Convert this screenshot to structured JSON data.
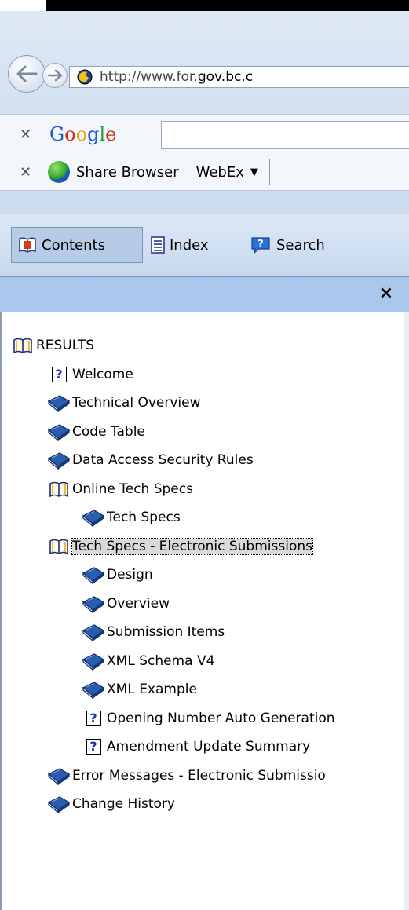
{
  "browser": {
    "address_prefix": "http://www.for.",
    "address_domain": "gov.bc.c",
    "google_label": "Google",
    "toolbar": {
      "share_browser_label": "Share Browser",
      "webex_label": "WebEx"
    }
  },
  "help": {
    "tabs": [
      {
        "label": "Contents",
        "active": true
      },
      {
        "label": "Index"
      },
      {
        "label": "Search"
      }
    ],
    "close_label": "×",
    "tree": [
      {
        "label": "RESULTS",
        "icon": "open-book-icon",
        "level": 0
      },
      {
        "label": "Welcome",
        "icon": "help-topic-icon",
        "level": 1
      },
      {
        "label": "Technical Overview",
        "icon": "closed-book-icon",
        "level": 1
      },
      {
        "label": "Code Table",
        "icon": "closed-book-icon",
        "level": 1
      },
      {
        "label": "Data Access Security Rules",
        "icon": "closed-book-icon",
        "level": 1
      },
      {
        "label": "Online Tech Specs",
        "icon": "open-book-icon",
        "level": 1
      },
      {
        "label": "Tech Specs",
        "icon": "closed-book-icon",
        "level": 2
      },
      {
        "label": "Tech Specs - Electronic Submissions",
        "icon": "open-book-icon",
        "level": 1,
        "selected": true
      },
      {
        "label": "Design",
        "icon": "closed-book-icon",
        "level": 2
      },
      {
        "label": "Overview",
        "icon": "closed-book-icon",
        "level": 2
      },
      {
        "label": "Submission Items",
        "icon": "closed-book-icon",
        "level": 2
      },
      {
        "label": "XML Schema V4",
        "icon": "closed-book-icon",
        "level": 2
      },
      {
        "label": "XML Example",
        "icon": "closed-book-icon",
        "level": 2
      },
      {
        "label": "Opening Number Auto Generation",
        "icon": "help-topic-icon",
        "level": 2
      },
      {
        "label": "Amendment Update Summary",
        "icon": "help-topic-icon",
        "level": 2
      },
      {
        "label": "Error Messages - Electronic Submissio",
        "icon": "closed-book-icon",
        "level": 1
      },
      {
        "label": "Change History",
        "icon": "closed-book-icon",
        "level": 1
      }
    ]
  },
  "colors": {
    "pane_header": "#a9c6ec",
    "selected_bg": "#d9d9d9",
    "book_blue": "#2a5db0"
  }
}
